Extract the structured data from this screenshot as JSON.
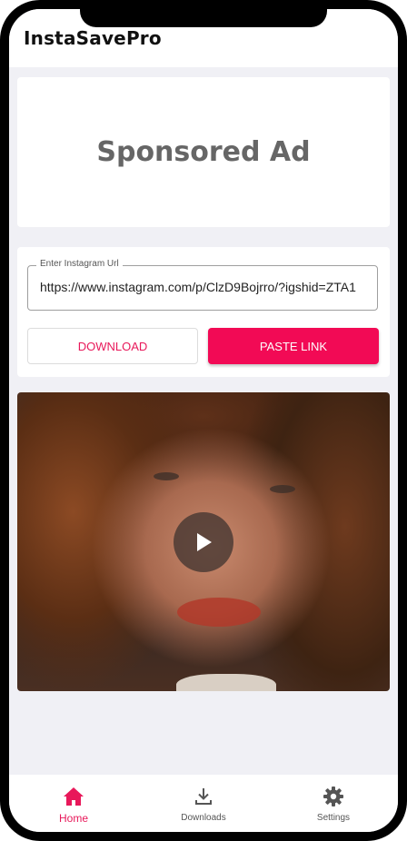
{
  "app": {
    "title": "InstaSavePro"
  },
  "ad": {
    "text": "Sponsored Ad"
  },
  "form": {
    "url_label": "Enter Instagram Url",
    "url_value": "https://www.instagram.com/p/ClzD9Bojrro/?igshid=ZTA1",
    "download_label": "DOWNLOAD",
    "paste_label": "PASTE LINK"
  },
  "video": {
    "play_icon": "play-icon"
  },
  "bottom_nav": {
    "items": [
      {
        "label": "Home",
        "icon": "home-icon",
        "active": true
      },
      {
        "label": "Downloads",
        "icon": "download-icon",
        "active": false
      },
      {
        "label": "Settings",
        "icon": "gear-icon",
        "active": false
      }
    ]
  },
  "colors": {
    "accent": "#f20a55",
    "background": "#f0f0f5",
    "ad_text": "#666666"
  }
}
